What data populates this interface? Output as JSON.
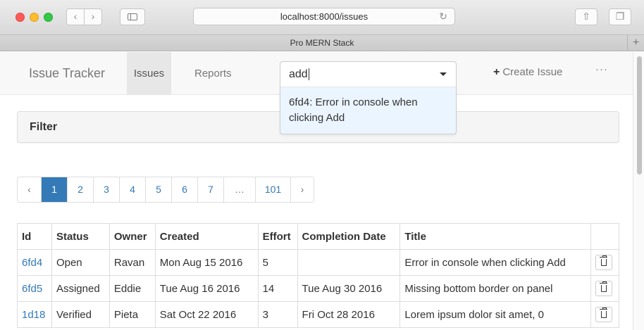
{
  "browser": {
    "url": "localhost:8000/issues",
    "tab_title": "Pro MERN Stack",
    "back_icon": "chevron-left-icon",
    "forward_icon": "chevron-right-icon",
    "reload_icon": "reload-icon",
    "share_icon": "share-icon",
    "tabs_icon": "tabs-icon",
    "new_tab_label": "+"
  },
  "navbar": {
    "brand": "Issue Tracker",
    "tabs": [
      {
        "label": "Issues",
        "active": true
      },
      {
        "label": "Reports",
        "active": false
      }
    ],
    "search": {
      "value": "add",
      "suggestions": [
        "6fd4: Error in console when clicking Add"
      ]
    },
    "create_issue_label": "Create Issue",
    "more_label": "···"
  },
  "filter": {
    "title": "Filter"
  },
  "pagination": {
    "prev": "‹",
    "next": "›",
    "pages": [
      "1",
      "2",
      "3",
      "4",
      "5",
      "6",
      "7",
      "…",
      "101"
    ],
    "active_page": "1"
  },
  "table": {
    "headers": [
      "Id",
      "Status",
      "Owner",
      "Created",
      "Effort",
      "Completion Date",
      "Title",
      ""
    ],
    "rows": [
      {
        "id": "6fd4",
        "status": "Open",
        "owner": "Ravan",
        "created": "Mon Aug 15 2016",
        "effort": "5",
        "completion": "",
        "title": "Error in console when clicking Add"
      },
      {
        "id": "6fd5",
        "status": "Assigned",
        "owner": "Eddie",
        "created": "Tue Aug 16 2016",
        "effort": "14",
        "completion": "Tue Aug 30 2016",
        "title": "Missing bottom border on panel"
      },
      {
        "id": "1d18",
        "status": "Verified",
        "owner": "Pieta",
        "created": "Sat Oct 22 2016",
        "effort": "3",
        "completion": "Fri Oct 28 2016",
        "title": "Lorem ipsum dolor sit amet, 0"
      }
    ]
  },
  "colors": {
    "link": "#337ab7",
    "active_page_bg": "#337ab7",
    "dropdown_bg": "#ebf5ff",
    "navbar_bg": "#f8f8f8"
  }
}
